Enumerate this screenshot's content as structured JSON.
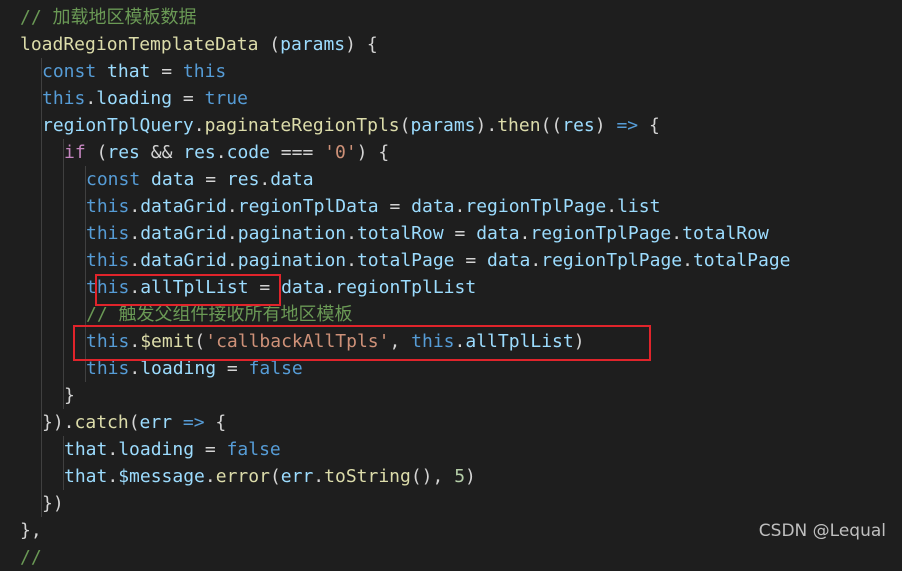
{
  "editor": {
    "lines": [
      {
        "indent": 1,
        "tokens": [
          {
            "t": "// 加载地区模板数据",
            "c": "cm"
          }
        ]
      },
      {
        "indent": 1,
        "tokens": [
          {
            "t": "loadRegionTemplateData",
            "c": "fn"
          },
          {
            "t": " (",
            "c": "op"
          },
          {
            "t": "params",
            "c": "var"
          },
          {
            "t": ") {",
            "c": "op"
          }
        ]
      },
      {
        "indent": 2,
        "tokens": [
          {
            "t": "const",
            "c": "kw"
          },
          {
            "t": " that",
            "c": "var"
          },
          {
            "t": " = ",
            "c": "op"
          },
          {
            "t": "this",
            "c": "kw"
          }
        ]
      },
      {
        "indent": 2,
        "tokens": [
          {
            "t": "this",
            "c": "kw"
          },
          {
            "t": ".",
            "c": "op"
          },
          {
            "t": "loading",
            "c": "var"
          },
          {
            "t": " = ",
            "c": "op"
          },
          {
            "t": "true",
            "c": "kw"
          }
        ]
      },
      {
        "indent": 2,
        "tokens": [
          {
            "t": "regionTplQuery",
            "c": "var"
          },
          {
            "t": ".",
            "c": "op"
          },
          {
            "t": "paginateRegionTpls",
            "c": "fn"
          },
          {
            "t": "(",
            "c": "op"
          },
          {
            "t": "params",
            "c": "var"
          },
          {
            "t": ").",
            "c": "op"
          },
          {
            "t": "then",
            "c": "fn"
          },
          {
            "t": "((",
            "c": "op"
          },
          {
            "t": "res",
            "c": "var"
          },
          {
            "t": ") ",
            "c": "op"
          },
          {
            "t": "=>",
            "c": "kw"
          },
          {
            "t": " {",
            "c": "op"
          }
        ]
      },
      {
        "indent": 3,
        "tokens": [
          {
            "t": "if",
            "c": "kw2"
          },
          {
            "t": " (",
            "c": "op"
          },
          {
            "t": "res",
            "c": "var"
          },
          {
            "t": " && ",
            "c": "op"
          },
          {
            "t": "res",
            "c": "var"
          },
          {
            "t": ".",
            "c": "op"
          },
          {
            "t": "code",
            "c": "var"
          },
          {
            "t": " === ",
            "c": "op"
          },
          {
            "t": "'0'",
            "c": "str"
          },
          {
            "t": ") {",
            "c": "op"
          }
        ]
      },
      {
        "indent": 4,
        "tokens": [
          {
            "t": "const",
            "c": "kw"
          },
          {
            "t": " data",
            "c": "var"
          },
          {
            "t": " = ",
            "c": "op"
          },
          {
            "t": "res",
            "c": "var"
          },
          {
            "t": ".",
            "c": "op"
          },
          {
            "t": "data",
            "c": "var"
          }
        ]
      },
      {
        "indent": 4,
        "tokens": [
          {
            "t": "this",
            "c": "kw"
          },
          {
            "t": ".",
            "c": "op"
          },
          {
            "t": "dataGrid",
            "c": "var"
          },
          {
            "t": ".",
            "c": "op"
          },
          {
            "t": "regionTplData",
            "c": "var"
          },
          {
            "t": " = ",
            "c": "op"
          },
          {
            "t": "data",
            "c": "var"
          },
          {
            "t": ".",
            "c": "op"
          },
          {
            "t": "regionTplPage",
            "c": "var"
          },
          {
            "t": ".",
            "c": "op"
          },
          {
            "t": "list",
            "c": "var"
          }
        ]
      },
      {
        "indent": 4,
        "tokens": [
          {
            "t": "this",
            "c": "kw"
          },
          {
            "t": ".",
            "c": "op"
          },
          {
            "t": "dataGrid",
            "c": "var"
          },
          {
            "t": ".",
            "c": "op"
          },
          {
            "t": "pagination",
            "c": "var"
          },
          {
            "t": ".",
            "c": "op"
          },
          {
            "t": "totalRow",
            "c": "var"
          },
          {
            "t": " = ",
            "c": "op"
          },
          {
            "t": "data",
            "c": "var"
          },
          {
            "t": ".",
            "c": "op"
          },
          {
            "t": "regionTplPage",
            "c": "var"
          },
          {
            "t": ".",
            "c": "op"
          },
          {
            "t": "totalRow",
            "c": "var"
          }
        ]
      },
      {
        "indent": 4,
        "tokens": [
          {
            "t": "this",
            "c": "kw"
          },
          {
            "t": ".",
            "c": "op"
          },
          {
            "t": "dataGrid",
            "c": "var"
          },
          {
            "t": ".",
            "c": "op"
          },
          {
            "t": "pagination",
            "c": "var"
          },
          {
            "t": ".",
            "c": "op"
          },
          {
            "t": "totalPage",
            "c": "var"
          },
          {
            "t": " = ",
            "c": "op"
          },
          {
            "t": "data",
            "c": "var"
          },
          {
            "t": ".",
            "c": "op"
          },
          {
            "t": "regionTplPage",
            "c": "var"
          },
          {
            "t": ".",
            "c": "op"
          },
          {
            "t": "totalPage",
            "c": "var"
          }
        ]
      },
      {
        "indent": 4,
        "tokens": [
          {
            "t": "this",
            "c": "kw"
          },
          {
            "t": ".",
            "c": "op"
          },
          {
            "t": "allTplList",
            "c": "var"
          },
          {
            "t": " = ",
            "c": "op"
          },
          {
            "t": "data",
            "c": "var"
          },
          {
            "t": ".",
            "c": "op"
          },
          {
            "t": "regionTplList",
            "c": "var"
          }
        ]
      },
      {
        "indent": 4,
        "tokens": [
          {
            "t": "// 触发父组件接收所有地区模板",
            "c": "cm"
          }
        ]
      },
      {
        "indent": 4,
        "tokens": [
          {
            "t": "this",
            "c": "kw"
          },
          {
            "t": ".",
            "c": "op"
          },
          {
            "t": "$emit",
            "c": "fn"
          },
          {
            "t": "(",
            "c": "op"
          },
          {
            "t": "'callbackAllTpls'",
            "c": "str"
          },
          {
            "t": ", ",
            "c": "op"
          },
          {
            "t": "this",
            "c": "kw"
          },
          {
            "t": ".",
            "c": "op"
          },
          {
            "t": "allTplList",
            "c": "var"
          },
          {
            "t": ")",
            "c": "op"
          }
        ]
      },
      {
        "indent": 4,
        "tokens": [
          {
            "t": "this",
            "c": "kw"
          },
          {
            "t": ".",
            "c": "op"
          },
          {
            "t": "loading",
            "c": "var"
          },
          {
            "t": " = ",
            "c": "op"
          },
          {
            "t": "false",
            "c": "kw"
          }
        ]
      },
      {
        "indent": 3,
        "tokens": [
          {
            "t": "}",
            "c": "op"
          }
        ]
      },
      {
        "indent": 2,
        "tokens": [
          {
            "t": "}).",
            "c": "op"
          },
          {
            "t": "catch",
            "c": "fn"
          },
          {
            "t": "(",
            "c": "op"
          },
          {
            "t": "err",
            "c": "var"
          },
          {
            "t": " ",
            "c": "op"
          },
          {
            "t": "=>",
            "c": "kw"
          },
          {
            "t": " {",
            "c": "op"
          }
        ]
      },
      {
        "indent": 3,
        "tokens": [
          {
            "t": "that",
            "c": "var"
          },
          {
            "t": ".",
            "c": "op"
          },
          {
            "t": "loading",
            "c": "var"
          },
          {
            "t": " = ",
            "c": "op"
          },
          {
            "t": "false",
            "c": "kw"
          }
        ]
      },
      {
        "indent": 3,
        "tokens": [
          {
            "t": "that",
            "c": "var"
          },
          {
            "t": ".",
            "c": "op"
          },
          {
            "t": "$message",
            "c": "var"
          },
          {
            "t": ".",
            "c": "op"
          },
          {
            "t": "error",
            "c": "fn"
          },
          {
            "t": "(",
            "c": "op"
          },
          {
            "t": "err",
            "c": "var"
          },
          {
            "t": ".",
            "c": "op"
          },
          {
            "t": "toString",
            "c": "fn"
          },
          {
            "t": "(), ",
            "c": "op"
          },
          {
            "t": "5",
            "c": "num"
          },
          {
            "t": ")",
            "c": "op"
          }
        ]
      },
      {
        "indent": 2,
        "tokens": [
          {
            "t": "})",
            "c": "op"
          }
        ]
      },
      {
        "indent": 1,
        "tokens": [
          {
            "t": "},",
            "c": "op"
          }
        ]
      },
      {
        "indent": 1,
        "tokens": [
          {
            "t": "//",
            "c": "cm"
          }
        ]
      }
    ]
  },
  "highlights": [
    {
      "name": "highlight-alltpllist",
      "label_line": 10
    },
    {
      "name": "highlight-emit",
      "label_line": 12
    }
  ],
  "watermark": {
    "text": "CSDN @Lequal"
  },
  "colors": {
    "background": "#1e1e1e",
    "highlight_border": "#e0242b"
  }
}
